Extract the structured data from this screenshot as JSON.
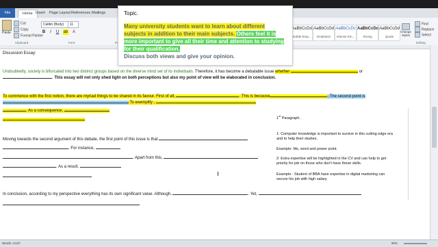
{
  "tabs": [
    "File",
    "Home",
    "Insert",
    "Page Layout",
    "References",
    "Mailings"
  ],
  "clipboard": {
    "paste": "Paste",
    "cut": "Cut",
    "copy": "Copy",
    "format_painter": "Format Painter",
    "group": "Clipboard"
  },
  "font": {
    "name": "Calibri (Body)",
    "size": "11",
    "group": "Font"
  },
  "paragraph_group": "Paragraph",
  "styles": [
    {
      "sample": "AaBbCcDd",
      "name": "Subtle Emp..."
    },
    {
      "sample": "AaBbCcDd",
      "name": "Emphasis"
    },
    {
      "sample": "AaBbCcDc",
      "name": "Intense Em..."
    },
    {
      "sample": "AaBbCcDc",
      "name": "Strong"
    },
    {
      "sample": "AaBbCcDd",
      "name": "Quote"
    }
  ],
  "change_styles": "Change Styles",
  "editing": {
    "find": "Find",
    "replace": "Replace",
    "select": "Select",
    "group": "Editing"
  },
  "topic": {
    "title": "Topic.",
    "part1": "Many university students want to learn about different subjects in addition to their main subjects. ",
    "part2": "Others feel it is more important to give all their time and attention to studying for their qualification.",
    "part3": "Discuss both views and give your opinion."
  },
  "doc": {
    "heading": "Discussion Essay:",
    "intro_a": "Undoubtedly, society is bifurcated into two distinct groups based on the diverse mind set of its individuals.",
    "intro_b": " Therefore, it has become a debatable issue ",
    "whether": "whether ",
    "or": " or",
    "intro_c": "This essay will not only shed light on both perceptions but also my point of view will be elaborated in conclusion.",
    "p2_a": "To commence with the first notion, there are myriad things to be shared in its favour. First of all, ",
    "p2_b": ". This is because",
    "p2_c": ". The second point is ",
    "p2_d": " To exemplify , ",
    "p2_e": ". As a consequence, ",
    "p3_a": "Moving towards the second argument of this debate, the first point of this issue is that ",
    "p3_b": ". For instance, ",
    "p3_c": ". Apart from this, ",
    "p3_d": ". As a result, ",
    "p4_a": "In conclusion, according to my perspective everything has its own significant value. Although, ",
    "p4_b": ". Yet, "
  },
  "side_notes": {
    "heading_sup": "st",
    "heading_num": "1",
    "heading_rest": " Paragraph.",
    "n1": "1:  Computer knowledge is important to survive in this cutting edge era and to help their studies.",
    "n2": "Example: Ms, word and power point.",
    "n3": "2:  Extra expertise will be highlighted in the CV and can help to get priority for job on those who don't have these skills.",
    "n4": "Example : Student of BBA have expertise in digital marketing can secure his job with high salary."
  },
  "status": {
    "words": "Words: 1/137",
    "zoom": "90%"
  }
}
